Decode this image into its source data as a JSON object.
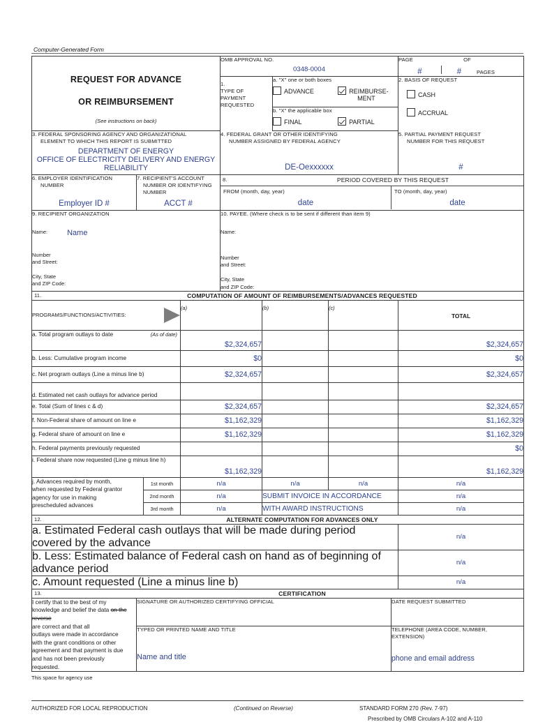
{
  "doc": {
    "computer_generated": "Computer-Generated Form",
    "title_line1": "REQUEST FOR ADVANCE",
    "title_line2": "OR REIMBURSEMENT",
    "instructions_note": "(See instructions on back)"
  },
  "omb": {
    "label": "OMB APPROVAL NO.",
    "value": "0348-0004"
  },
  "page": {
    "page_label": "PAGE",
    "of_label": "OF",
    "pages_label": "PAGES",
    "page_value": "#",
    "of_value": "#"
  },
  "item1": {
    "number": "1.",
    "label_lines": [
      "TYPE OF",
      "PAYMENT",
      "REQUESTED"
    ],
    "a_instruction": "a.  \"X\" one or both boxes",
    "advance_label": "ADVANCE",
    "advance_checked": false,
    "reimbursement_label_line1": "REIMBURSE-",
    "reimbursement_label_line2": "MENT",
    "reimbursement_checked": true,
    "b_instruction": "b.  \"X\" the applicable box",
    "final_label": "FINAL",
    "final_checked": false,
    "partial_label": "PARTIAL",
    "partial_checked": true
  },
  "item2": {
    "heading": "2.  BASIS OF REQUEST",
    "cash_label": "CASH",
    "cash_checked": false,
    "accrual_label": "ACCRUAL",
    "accrual_checked": false
  },
  "item3": {
    "label_line1": "3.  FEDERAL SPONSORING AGENCY AND ORGANIZATIONAL",
    "label_line2": "ELEMENT TO WHICH THIS REPORT IS SUBMITTED",
    "value_line1": "DEPARTMENT OF ENERGY",
    "value_line2": "OFFICE OF ELECTRICITY DELIVERY AND ENERGY",
    "value_line3": "RELIABILITY"
  },
  "item4": {
    "label_line1": "4.  FEDERAL GRANT OR OTHER IDENTIFYING",
    "label_line2": "NUMBER ASSIGNED BY FEDERAL AGENCY",
    "value": "DE-Oexxxxxx"
  },
  "item5": {
    "label_line1": "5.  PARTIAL PAYMENT REQUEST",
    "label_line2": "NUMBER FOR THIS REQUEST",
    "value": "#"
  },
  "item6": {
    "label_line1": "6.  EMPLOYER IDENTIFICATION",
    "label_line2": "NUMBER",
    "value": "Employer ID #"
  },
  "item7": {
    "label_line1": "7.  RECIPIENT'S ACCOUNT",
    "label_line2": "NUMBER OR IDENTIFYING",
    "label_line3": "NUMBER",
    "value": "ACCT #"
  },
  "item8": {
    "number": "8.",
    "heading": "PERIOD COVERED BY THIS REQUEST",
    "from_label": "FROM   (month, day, year)",
    "from_value": "date",
    "to_label": "TO  (month, day, year)",
    "to_value": "date"
  },
  "item9": {
    "heading": "9.  RECIPIENT ORGANIZATION",
    "name_label": "Name:",
    "name_value": "Name",
    "street_label_line1": "Number",
    "street_label_line2": "and Street:",
    "city_label_line1": "City, State",
    "city_label_line2": "and ZIP Code:"
  },
  "item10": {
    "heading": "10.  PAYEE.  (Where check is to be sent if different than item 9)",
    "name_label": "Name:",
    "street_label_line1": "Number",
    "street_label_line2": "and Street:",
    "city_label_line1": "City, State",
    "city_label_line2": "and ZIP Code:"
  },
  "item11": {
    "number": "11.",
    "heading": "COMPUTATION OF AMOUNT OF REIMBURSEMENTS/ADVANCES REQUESTED",
    "programs_label": "PROGRAMS/FUNCTIONS/ACTIVITIES:",
    "col_a": "(a)",
    "col_b": "(b)",
    "col_c": "(c)",
    "col_total": "TOTAL",
    "as_of_date": "(As of date)",
    "rows": [
      {
        "label": "a.  Total program outlays to date",
        "a": "$2,324,657",
        "b": "",
        "c": "",
        "total": "$2,324,657"
      },
      {
        "label": "b.  Less:  Cumulative program income",
        "a": "$0",
        "b": "",
        "c": "",
        "total": "$0"
      },
      {
        "label": "c.  Net program outlays (Line a minus line b)",
        "a": "$2,324,657",
        "b": "",
        "c": "",
        "total": "$2,324,657"
      },
      {
        "label": "d.  Estimated net cash outlays for advance period",
        "a": "",
        "b": "",
        "c": "",
        "total": ""
      },
      {
        "label": "e.  Total (Sum of lines c & d)",
        "a": "$2,324,657",
        "b": "",
        "c": "",
        "total": "$2,324,657"
      },
      {
        "label": "f.  Non-Federal share of amount on line e",
        "a": "$1,162,329",
        "b": "",
        "c": "",
        "total": "$1,162,329"
      },
      {
        "label": "g.  Federal share of amount on line e",
        "a": "$1,162,329",
        "b": "",
        "c": "",
        "total": "$1,162,329"
      },
      {
        "label": "h.  Federal payments previously requested",
        "a": "",
        "b": "",
        "c": "",
        "total": "$0"
      },
      {
        "label": "i.  Federal share now requested (Line g minus line h)",
        "a": "$1,162,329",
        "b": "",
        "c": "",
        "total": "$1,162,329"
      }
    ],
    "j_label_lines": [
      "j.  Advances required by month,",
      "when requested by Federal grantor",
      "agency for use in making",
      "prescheduled advances"
    ],
    "months": [
      {
        "label": "1st month",
        "a": "n/a",
        "b": "n/a",
        "c": "n/a",
        "total": "n/a"
      },
      {
        "label": "2nd month",
        "a": "n/a",
        "total": "n/a"
      },
      {
        "label": "3rd month",
        "a": "n/a",
        "total": "n/a"
      }
    ],
    "message_line1": "SUBMIT INVOICE IN ACCORDANCE",
    "message_line2": "WITH AWARD INSTRUCTIONS"
  },
  "item12": {
    "number": "12.",
    "heading": "ALTERNATE COMPUTATION FOR ADVANCES ONLY",
    "rows": [
      {
        "label": "a.  Estimated Federal cash outlays that will be made during period covered by the advance",
        "value": "n/a"
      },
      {
        "label": "b.  Less:  Estimated balance of Federal cash on hand as of beginning of advance period",
        "value": "n/a"
      },
      {
        "label": "c.  Amount requested (Line a minus line b)",
        "value": "n/a"
      }
    ]
  },
  "item13": {
    "number": "13.",
    "heading": "CERTIFICATION",
    "certify_lines": [
      "I certify that to the best of my",
      "knowledge and belief the data",
      "on the reverse",
      "are correct and that all",
      "outlays were made in accordance",
      "with the grant conditions or other",
      "agreement and that payment is due",
      "and has not been previously",
      "requested."
    ],
    "signature_label": "SIGNATURE OR AUTHORIZED CERTIFYING OFFICIAL",
    "date_label": "DATE REQUEST SUBMITTED",
    "typed_name_label": "TYPED OR PRINTED NAME AND TITLE",
    "typed_name_value": "Name and title",
    "telephone_label_line1": "TELEPHONE (AREA CODE, NUMBER,",
    "telephone_label_line2": "EXTENSION)",
    "telephone_value": "phone and email address",
    "agency_use": "This space for agency use"
  },
  "footer": {
    "left": "AUTHORIZED FOR LOCAL REPRODUCTION",
    "center": "(Continued on Reverse)",
    "right_line1": "STANDARD FORM 270 (Rev. 7-97)",
    "right_line2": "Prescribed by OMB Circulars A-102 and A-110"
  }
}
